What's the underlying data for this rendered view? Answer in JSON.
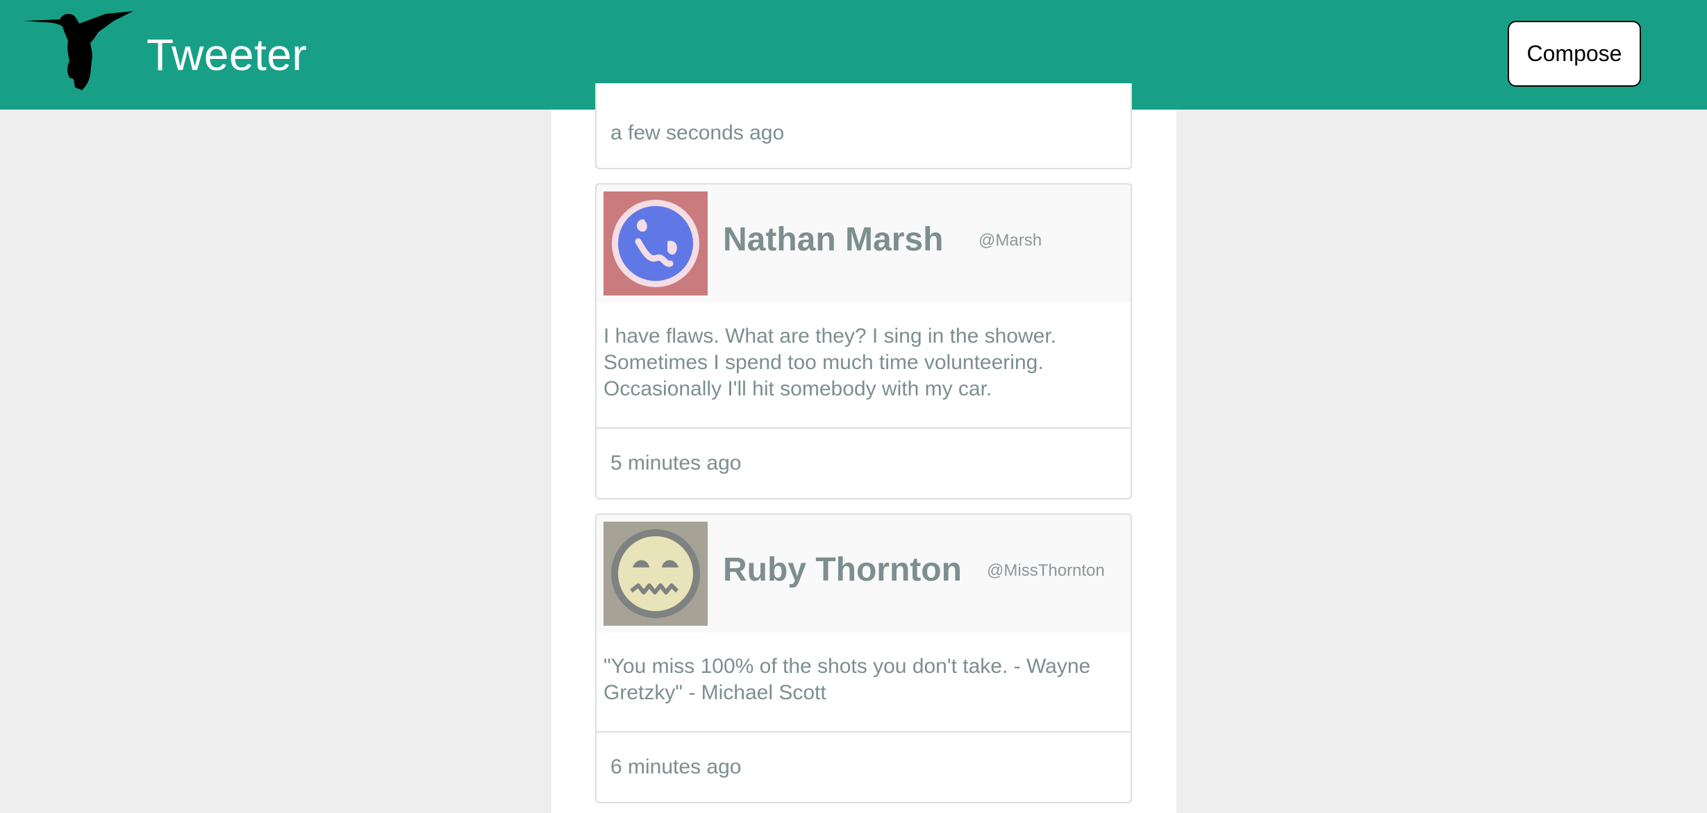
{
  "header": {
    "brand": "Tweeter",
    "logo_icon": "hummingbird-icon",
    "compose_label": "Compose"
  },
  "colors": {
    "navbar": "#18a087",
    "background": "#eeeeee",
    "text_muted": "#7d8e8e"
  },
  "tweets": [
    {
      "time": "a few seconds ago"
    },
    {
      "name": "Nathan Marsh",
      "handle": "@Marsh",
      "avatar_icon": "blue-face-avatar",
      "body": "I have flaws. What are they? I sing in the shower. Sometimes I spend too much time volunteering. Occasionally I'll hit somebody with my car.",
      "time": "5 minutes ago"
    },
    {
      "name": "Ruby Thornton",
      "handle": "@MissThornton",
      "avatar_icon": "grimace-face-avatar",
      "body": "\"You miss 100% of the shots you don't take. - Wayne Gretzky\" - Michael Scott",
      "time": "6 minutes ago"
    }
  ]
}
